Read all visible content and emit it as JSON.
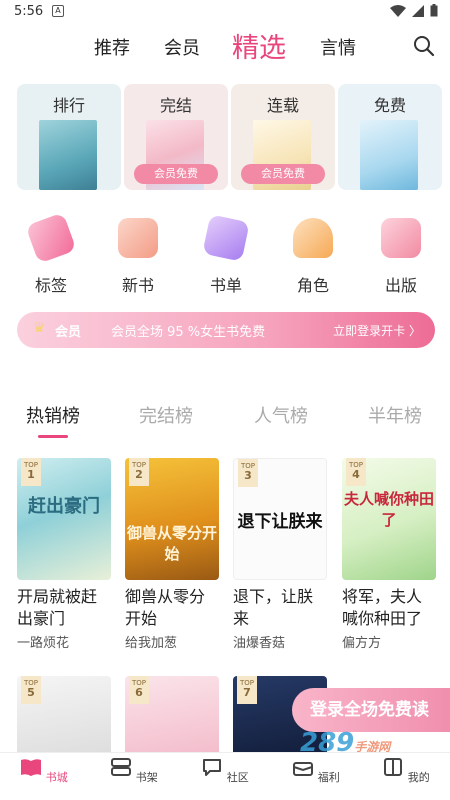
{
  "status": {
    "time": "5:56"
  },
  "nav": {
    "tabs": [
      "推荐",
      "会员",
      "精选",
      "言情"
    ],
    "active_index": 2
  },
  "categories": [
    {
      "label": "排行",
      "badge": ""
    },
    {
      "label": "完结",
      "badge": "会员免费"
    },
    {
      "label": "连载",
      "badge": "会员免费"
    },
    {
      "label": "免费",
      "badge": ""
    }
  ],
  "quick_links": [
    "标签",
    "新书",
    "书单",
    "角色",
    "出版"
  ],
  "vip_banner": {
    "label": "会员",
    "text": "会员全场 95 %女生书免费",
    "action": "立即登录开卡 〉"
  },
  "rank_tabs": [
    "热销榜",
    "完结榜",
    "人气榜",
    "半年榜"
  ],
  "books": [
    {
      "rank": "1",
      "title": "开局就被赶出豪门",
      "author": "一路烦花",
      "cover_text": "赶出豪门"
    },
    {
      "rank": "2",
      "title": "御兽从零分开始",
      "author": "给我加葱",
      "cover_text": "御兽从零分开始"
    },
    {
      "rank": "3",
      "title": "退下，让朕来",
      "author": "油爆香菇",
      "cover_text": "退下让朕来"
    },
    {
      "rank": "4",
      "title": "将军，夫人喊你种田了",
      "author": "偏方方",
      "cover_text": "夫人喊你种田了"
    }
  ],
  "books_row2": [
    {
      "rank": "5"
    },
    {
      "rank": "6"
    },
    {
      "rank": "7"
    }
  ],
  "promo": {
    "text": "登录全场免费读"
  },
  "watermark": {
    "text": "289",
    "sub": "手游网"
  },
  "bottom_nav": [
    "书城",
    "书架",
    "社区",
    "福利",
    "我的"
  ],
  "colors": {
    "accent": "#e8467c"
  }
}
